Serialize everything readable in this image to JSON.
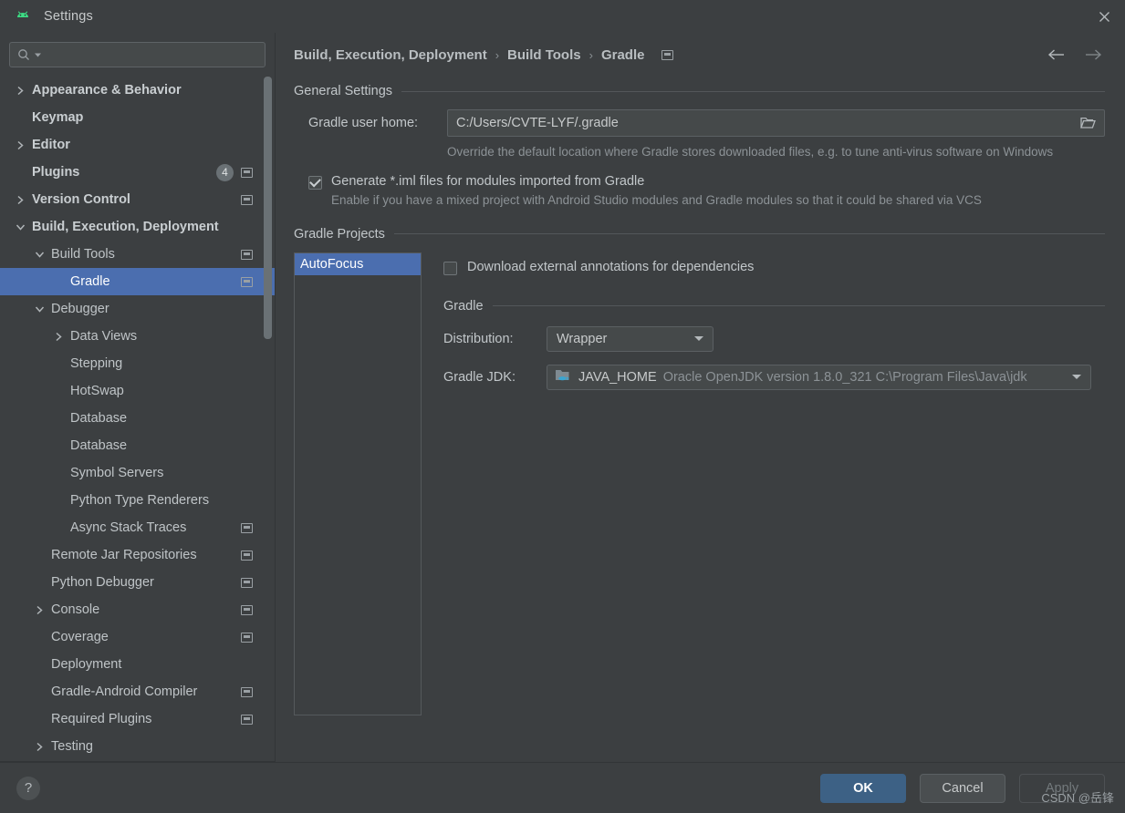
{
  "window": {
    "title": "Settings",
    "app_icon": "android-icon",
    "close_icon": "close-icon"
  },
  "search": {
    "placeholder": "",
    "value": "",
    "icon": "search-icon"
  },
  "sidebar": {
    "items": [
      {
        "label": "Appearance & Behavior",
        "arrow": "chevron-right",
        "indent": 0,
        "bold": true,
        "marker": false,
        "badge": null,
        "selected": false
      },
      {
        "label": "Keymap",
        "arrow": "none",
        "indent": 0,
        "bold": true,
        "marker": false,
        "badge": null,
        "selected": false
      },
      {
        "label": "Editor",
        "arrow": "chevron-right",
        "indent": 0,
        "bold": true,
        "marker": false,
        "badge": null,
        "selected": false
      },
      {
        "label": "Plugins",
        "arrow": "none",
        "indent": 0,
        "bold": true,
        "marker": true,
        "badge": "4",
        "selected": false
      },
      {
        "label": "Version Control",
        "arrow": "chevron-right",
        "indent": 0,
        "bold": true,
        "marker": true,
        "badge": null,
        "selected": false
      },
      {
        "label": "Build, Execution, Deployment",
        "arrow": "chevron-down",
        "indent": 0,
        "bold": true,
        "marker": false,
        "badge": null,
        "selected": false
      },
      {
        "label": "Build Tools",
        "arrow": "chevron-down",
        "indent": 1,
        "bold": false,
        "marker": true,
        "badge": null,
        "selected": false
      },
      {
        "label": "Gradle",
        "arrow": "none",
        "indent": 2,
        "bold": false,
        "marker": true,
        "badge": null,
        "selected": true
      },
      {
        "label": "Debugger",
        "arrow": "chevron-down",
        "indent": 1,
        "bold": false,
        "marker": false,
        "badge": null,
        "selected": false
      },
      {
        "label": "Data Views",
        "arrow": "chevron-right",
        "indent": 2,
        "bold": false,
        "marker": false,
        "badge": null,
        "selected": false
      },
      {
        "label": "Stepping",
        "arrow": "none",
        "indent": 2,
        "bold": false,
        "marker": false,
        "badge": null,
        "selected": false
      },
      {
        "label": "HotSwap",
        "arrow": "none",
        "indent": 2,
        "bold": false,
        "marker": false,
        "badge": null,
        "selected": false
      },
      {
        "label": "Database",
        "arrow": "none",
        "indent": 2,
        "bold": false,
        "marker": false,
        "badge": null,
        "selected": false
      },
      {
        "label": "Database",
        "arrow": "none",
        "indent": 2,
        "bold": false,
        "marker": false,
        "badge": null,
        "selected": false
      },
      {
        "label": "Symbol Servers",
        "arrow": "none",
        "indent": 2,
        "bold": false,
        "marker": false,
        "badge": null,
        "selected": false
      },
      {
        "label": "Python Type Renderers",
        "arrow": "none",
        "indent": 2,
        "bold": false,
        "marker": false,
        "badge": null,
        "selected": false
      },
      {
        "label": "Async Stack Traces",
        "arrow": "none",
        "indent": 2,
        "bold": false,
        "marker": true,
        "badge": null,
        "selected": false
      },
      {
        "label": "Remote Jar Repositories",
        "arrow": "none",
        "indent": 1,
        "bold": false,
        "marker": true,
        "badge": null,
        "selected": false
      },
      {
        "label": "Python Debugger",
        "arrow": "none",
        "indent": 1,
        "bold": false,
        "marker": true,
        "badge": null,
        "selected": false
      },
      {
        "label": "Console",
        "arrow": "chevron-right",
        "indent": 1,
        "bold": false,
        "marker": true,
        "badge": null,
        "selected": false
      },
      {
        "label": "Coverage",
        "arrow": "none",
        "indent": 1,
        "bold": false,
        "marker": true,
        "badge": null,
        "selected": false
      },
      {
        "label": "Deployment",
        "arrow": "none",
        "indent": 1,
        "bold": false,
        "marker": false,
        "badge": null,
        "selected": false
      },
      {
        "label": "Gradle-Android Compiler",
        "arrow": "none",
        "indent": 1,
        "bold": false,
        "marker": true,
        "badge": null,
        "selected": false
      },
      {
        "label": "Required Plugins",
        "arrow": "none",
        "indent": 1,
        "bold": false,
        "marker": true,
        "badge": null,
        "selected": false
      },
      {
        "label": "Testing",
        "arrow": "chevron-right",
        "indent": 1,
        "bold": false,
        "marker": false,
        "badge": null,
        "selected": false
      }
    ]
  },
  "breadcrumb": {
    "items": [
      "Build, Execution, Deployment",
      "Build Tools",
      "Gradle"
    ],
    "separator": "›",
    "marker_icon": "project-settings-icon",
    "back_icon": "arrow-left-icon",
    "forward_icon": "arrow-right-icon"
  },
  "general_settings": {
    "title": "General Settings",
    "gradle_user_home": {
      "label": "Gradle user home:",
      "value": "C:/Users/CVTE-LYF/.gradle",
      "placeholder": "",
      "browse_icon": "folder-icon"
    },
    "hint": "Override the default location where Gradle stores downloaded files, e.g. to tune anti-virus software on Windows",
    "generate_iml": {
      "label": "Generate *.iml files for modules imported from Gradle",
      "checked": true,
      "sub": "Enable if you have a mixed project with Android Studio modules and Gradle modules so that it could be shared via VCS"
    }
  },
  "gradle_projects": {
    "title": "Gradle Projects",
    "list": [
      {
        "label": "AutoFocus",
        "selected": true
      }
    ],
    "download_annotations": {
      "label": "Download external annotations for dependencies",
      "checked": false
    },
    "gradle_section_title": "Gradle",
    "distribution": {
      "label": "Distribution:",
      "value": "Wrapper"
    },
    "gradle_jdk": {
      "label": "Gradle JDK:",
      "icon": "java-folder-icon",
      "name": "JAVA_HOME",
      "description": "Oracle OpenJDK version 1.8.0_321 C:\\Program Files\\Java\\jdk"
    }
  },
  "footer": {
    "help_label": "?",
    "ok_label": "OK",
    "cancel_label": "Cancel",
    "apply_label": "Apply",
    "apply_enabled": false
  },
  "watermark": "CSDN @岳锋",
  "colors": {
    "background": "#3c3f41",
    "selection": "#4b6eaf",
    "primary_button": "#3d6185",
    "text": "#c2c7ca",
    "muted_text": "#8c9296",
    "field": "#45494a"
  }
}
